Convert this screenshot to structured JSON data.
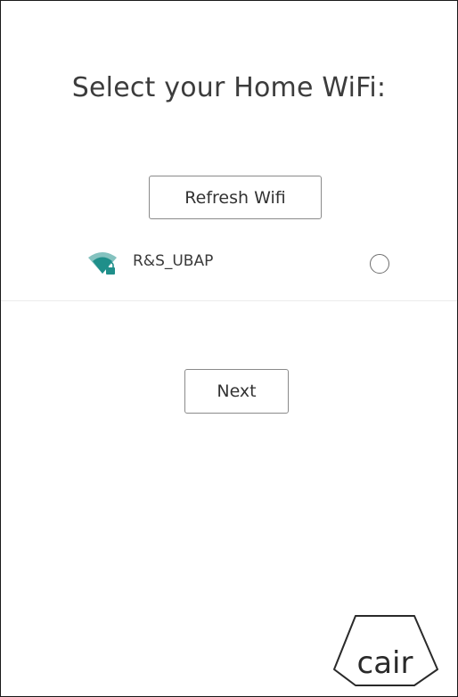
{
  "header": {
    "title": "Select your Home WiFi:"
  },
  "actions": {
    "refresh_label": "Refresh Wifi",
    "next_label": "Next"
  },
  "networks": [
    {
      "ssid": "R&S_UBAP",
      "icon": "wifi-locked-icon",
      "selected": false
    }
  ],
  "brand": {
    "logo_text": "cair"
  },
  "colors": {
    "wifi_icon": "#1f8f8a",
    "lock": "#1f8f8a",
    "border": "#8a8a8a"
  }
}
